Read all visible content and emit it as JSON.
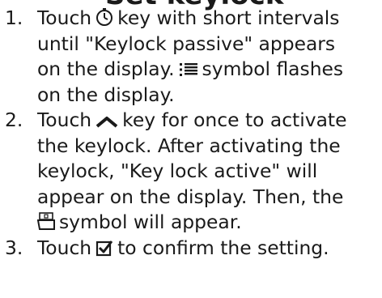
{
  "document": {
    "cut_heading_text": "Set keylock",
    "steps": [
      {
        "number": "1.",
        "lines": [
          [
            "Touch",
            "key with short intervals"
          ],
          [
            "until \"Keylock passive\" appears"
          ],
          [
            "on the display.",
            "symbol flashes"
          ],
          [
            "on the display."
          ]
        ]
      },
      {
        "number": "2.",
        "lines": [
          [
            "Touch",
            "key for once to activate"
          ],
          [
            "the keylock. After activating the"
          ],
          [
            "keylock, \"Key lock active\" will"
          ],
          [
            "appear on the display. Then, the"
          ],
          [
            "symbol will appear."
          ]
        ]
      },
      {
        "number": "3.",
        "lines": [
          [
            "Touch",
            "to confirm the setting."
          ]
        ]
      }
    ],
    "icons": {
      "timer": "timer-icon",
      "menu_lines": "menu-lines-icon",
      "up_chevron": "up-chevron-icon",
      "keylock": "keylock-icon",
      "confirm_checkbox": "confirm-checkbox-icon"
    }
  }
}
